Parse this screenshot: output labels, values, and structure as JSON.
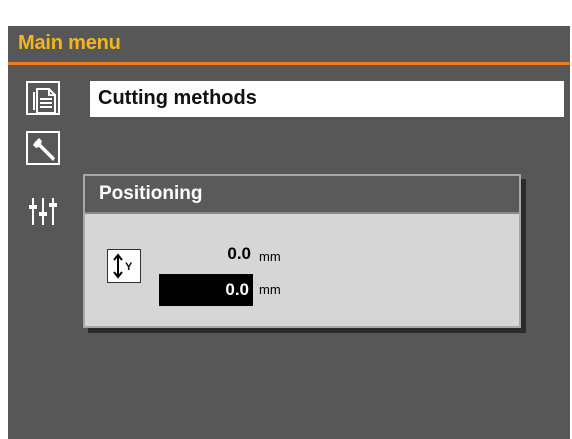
{
  "header": {
    "title": "Main menu"
  },
  "menu": {
    "selected_item": "Cutting methods"
  },
  "sidebar": {
    "icons": [
      {
        "name": "document-icon"
      },
      {
        "name": "wrench-icon"
      },
      {
        "name": "sliders-icon"
      }
    ]
  },
  "dialog": {
    "title": "Positioning",
    "axis_label": "Y",
    "current_value": "0.0",
    "current_unit": "mm",
    "target_value": "0.0",
    "target_unit": "mm"
  },
  "colors": {
    "panel_bg": "#575757",
    "title_text": "#f5b51d",
    "accent_line": "#f07a1e",
    "dialog_bg": "#d6d6d6"
  }
}
